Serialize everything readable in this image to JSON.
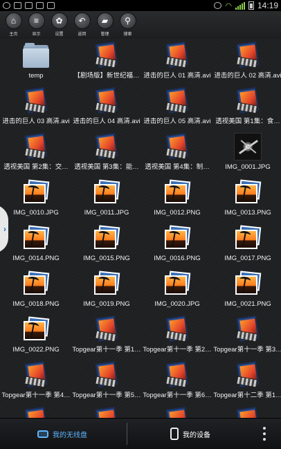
{
  "status_bar": {
    "time": "14:19"
  },
  "toolbar": {
    "buttons": [
      {
        "label": "主页",
        "icon": "home-icon",
        "glyph": "⌂"
      },
      {
        "label": "显示",
        "icon": "list-icon",
        "glyph": "≡"
      },
      {
        "label": "设置",
        "icon": "gear-icon",
        "glyph": "✿"
      },
      {
        "label": "返回",
        "icon": "back-arrow-icon",
        "glyph": "↶"
      },
      {
        "label": "管理",
        "icon": "folder-icon",
        "glyph": "▰"
      },
      {
        "label": "搜索",
        "icon": "search-icon",
        "glyph": "⚲"
      }
    ]
  },
  "files": [
    {
      "name": "temp",
      "type": "folder"
    },
    {
      "name": "【剧场版】新世纪福…",
      "type": "video"
    },
    {
      "name": "进击的巨人 01 高清.avi",
      "type": "video"
    },
    {
      "name": "进击的巨人 02 高清.avi",
      "type": "video"
    },
    {
      "name": "进击的巨人 03 高清.avi",
      "type": "video"
    },
    {
      "name": "进击的巨人 04 高清.avi",
      "type": "video"
    },
    {
      "name": "进击的巨人 05 高清.avi",
      "type": "video"
    },
    {
      "name": "透视美国 第1集：食…",
      "type": "video"
    },
    {
      "name": "透视美国 第2集：交…",
      "type": "video"
    },
    {
      "name": "透视美国 第3集：能…",
      "type": "video"
    },
    {
      "name": "透视美国 第4集：制…",
      "type": "video"
    },
    {
      "name": "IMG_0001.JPG",
      "type": "photo"
    },
    {
      "name": "IMG_0010.JPG",
      "type": "image"
    },
    {
      "name": "IMG_0011.JPG",
      "type": "image"
    },
    {
      "name": "IMG_0012.PNG",
      "type": "image"
    },
    {
      "name": "IMG_0013.PNG",
      "type": "image"
    },
    {
      "name": "IMG_0014.PNG",
      "type": "image"
    },
    {
      "name": "IMG_0015.PNG",
      "type": "image"
    },
    {
      "name": "IMG_0016.PNG",
      "type": "image"
    },
    {
      "name": "IMG_0017.PNG",
      "type": "image"
    },
    {
      "name": "IMG_0018.PNG",
      "type": "image"
    },
    {
      "name": "IMG_0019.PNG",
      "type": "image"
    },
    {
      "name": "IMG_0020.JPG",
      "type": "image"
    },
    {
      "name": "IMG_0021.PNG",
      "type": "image"
    },
    {
      "name": "IMG_0022.PNG",
      "type": "image"
    },
    {
      "name": "Topgear第十一季 第1…",
      "type": "video"
    },
    {
      "name": "Topgear第十一季 第2…",
      "type": "video"
    },
    {
      "name": "Topgear第十一季 第3…",
      "type": "video"
    },
    {
      "name": "Topgear第十一季 第4…",
      "type": "video"
    },
    {
      "name": "Topgear第十一季 第5…",
      "type": "video"
    },
    {
      "name": "Topgear第十一季 第6…",
      "type": "video"
    },
    {
      "name": "Topgear第十二季 第1…",
      "type": "video"
    },
    {
      "name": "",
      "type": "video"
    },
    {
      "name": "",
      "type": "video"
    },
    {
      "name": "",
      "type": "video"
    },
    {
      "name": "",
      "type": "video"
    }
  ],
  "bottom_bar": {
    "left_label": "我的无线盘",
    "right_label": "我的设备",
    "accent_color": "#5db6ff"
  }
}
